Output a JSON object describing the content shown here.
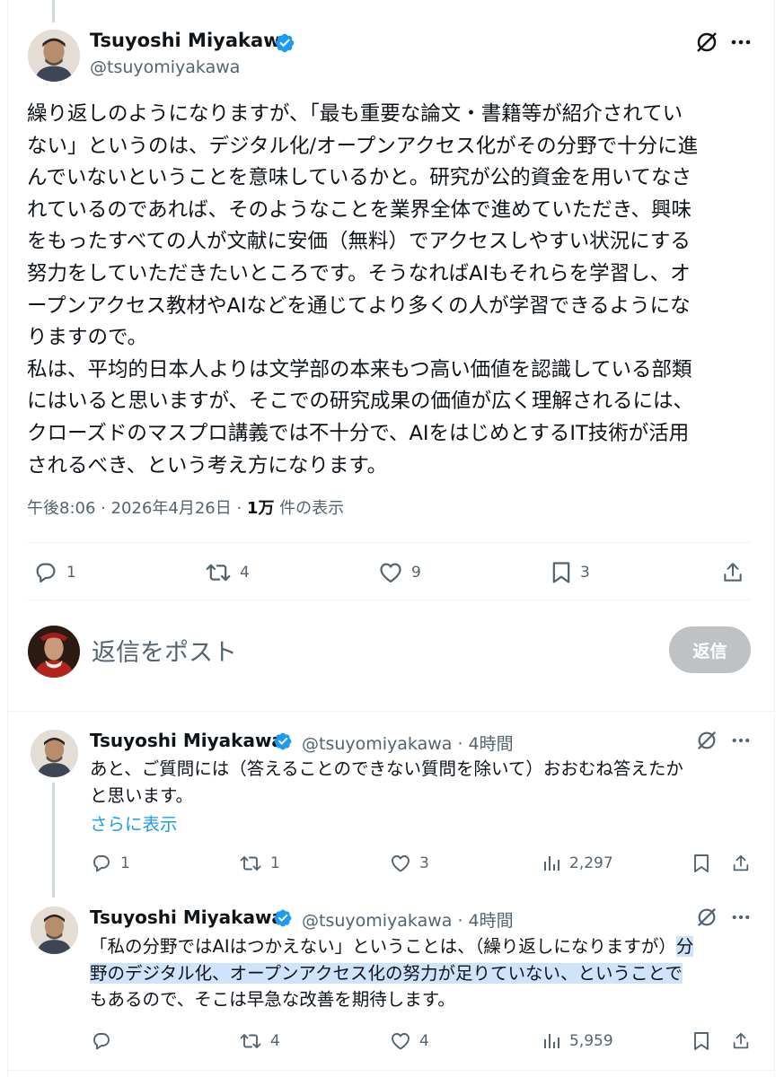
{
  "main_post": {
    "author": "Tsuyoshi Miyakawa",
    "handle": "@tsuyomiyakawa",
    "text_lines": [
      "繰り返しのようになりますが、「最も重要な論文・書籍等が紹介されてい",
      "ない」というのは、デジタル化/オープンアクセス化がその分野で十分に進",
      "んでいないということを意味しているかと。研究が公的資金を用いてなさ",
      "れているのであれば、そのようなことを業界全体で進めていただき、興味",
      "をもったすべての人が文献に安価（無料）でアクセスしやすい状況にする",
      "努力をしていただきたいところです。そうなればAIもそれらを学習し、オ",
      "ープンアクセス教材やAIなどを通じてより多くの人が学習できるようにな",
      "りますので。",
      "私は、平均的日本人よりは文学部の本来もつ高い価値を認識している部類",
      "にはいると思いますが、そこでの研究成果の価値が広く理解されるには、",
      "クローズドのマスプロ講義では不十分で、AIをはじめとするIT技術が活用",
      "されるべき、という考え方になります。"
    ],
    "time": "午後8:06 · 2026年4月26日 · ",
    "views_count": "1万",
    "views_label": " 件の表示",
    "replies": "1",
    "reposts": "4",
    "likes": "9",
    "bookmarks": "3"
  },
  "compose": {
    "placeholder": "返信をポスト",
    "button_label": "返信"
  },
  "replies": [
    {
      "author": "Tsuyoshi Miyakawa",
      "handle_time": "@tsuyomiyakawa · 4時間",
      "text_lines": [
        "あと、ご質問には（答えることのできない質問を除いて）おおむね答えたか",
        "と思います。"
      ],
      "show_more": "さらに表示",
      "replies": "1",
      "reposts": "1",
      "likes": "3",
      "views": "2,297"
    },
    {
      "author": "Tsuyoshi Miyakawa",
      "handle_time": "@tsuyomiyakawa · 4時間",
      "line1_plain": "「私の分野ではAIはつかえない」ということは、（繰り返しになりますが）",
      "line1_highlight": "分",
      "line2_highlight": "野のデジタル化、オープンアクセス化の努力が足りていない、ということで",
      "line3": "もあるので、そこは早急な改善を期待します。",
      "replies": "",
      "reposts": "4",
      "likes": "4",
      "views": "5,959"
    }
  ],
  "colors": {
    "accent": "#1d9bf0",
    "secondary_text": "#536471",
    "highlight": "#cfe4fb",
    "button_disabled": "#bec2c5"
  }
}
